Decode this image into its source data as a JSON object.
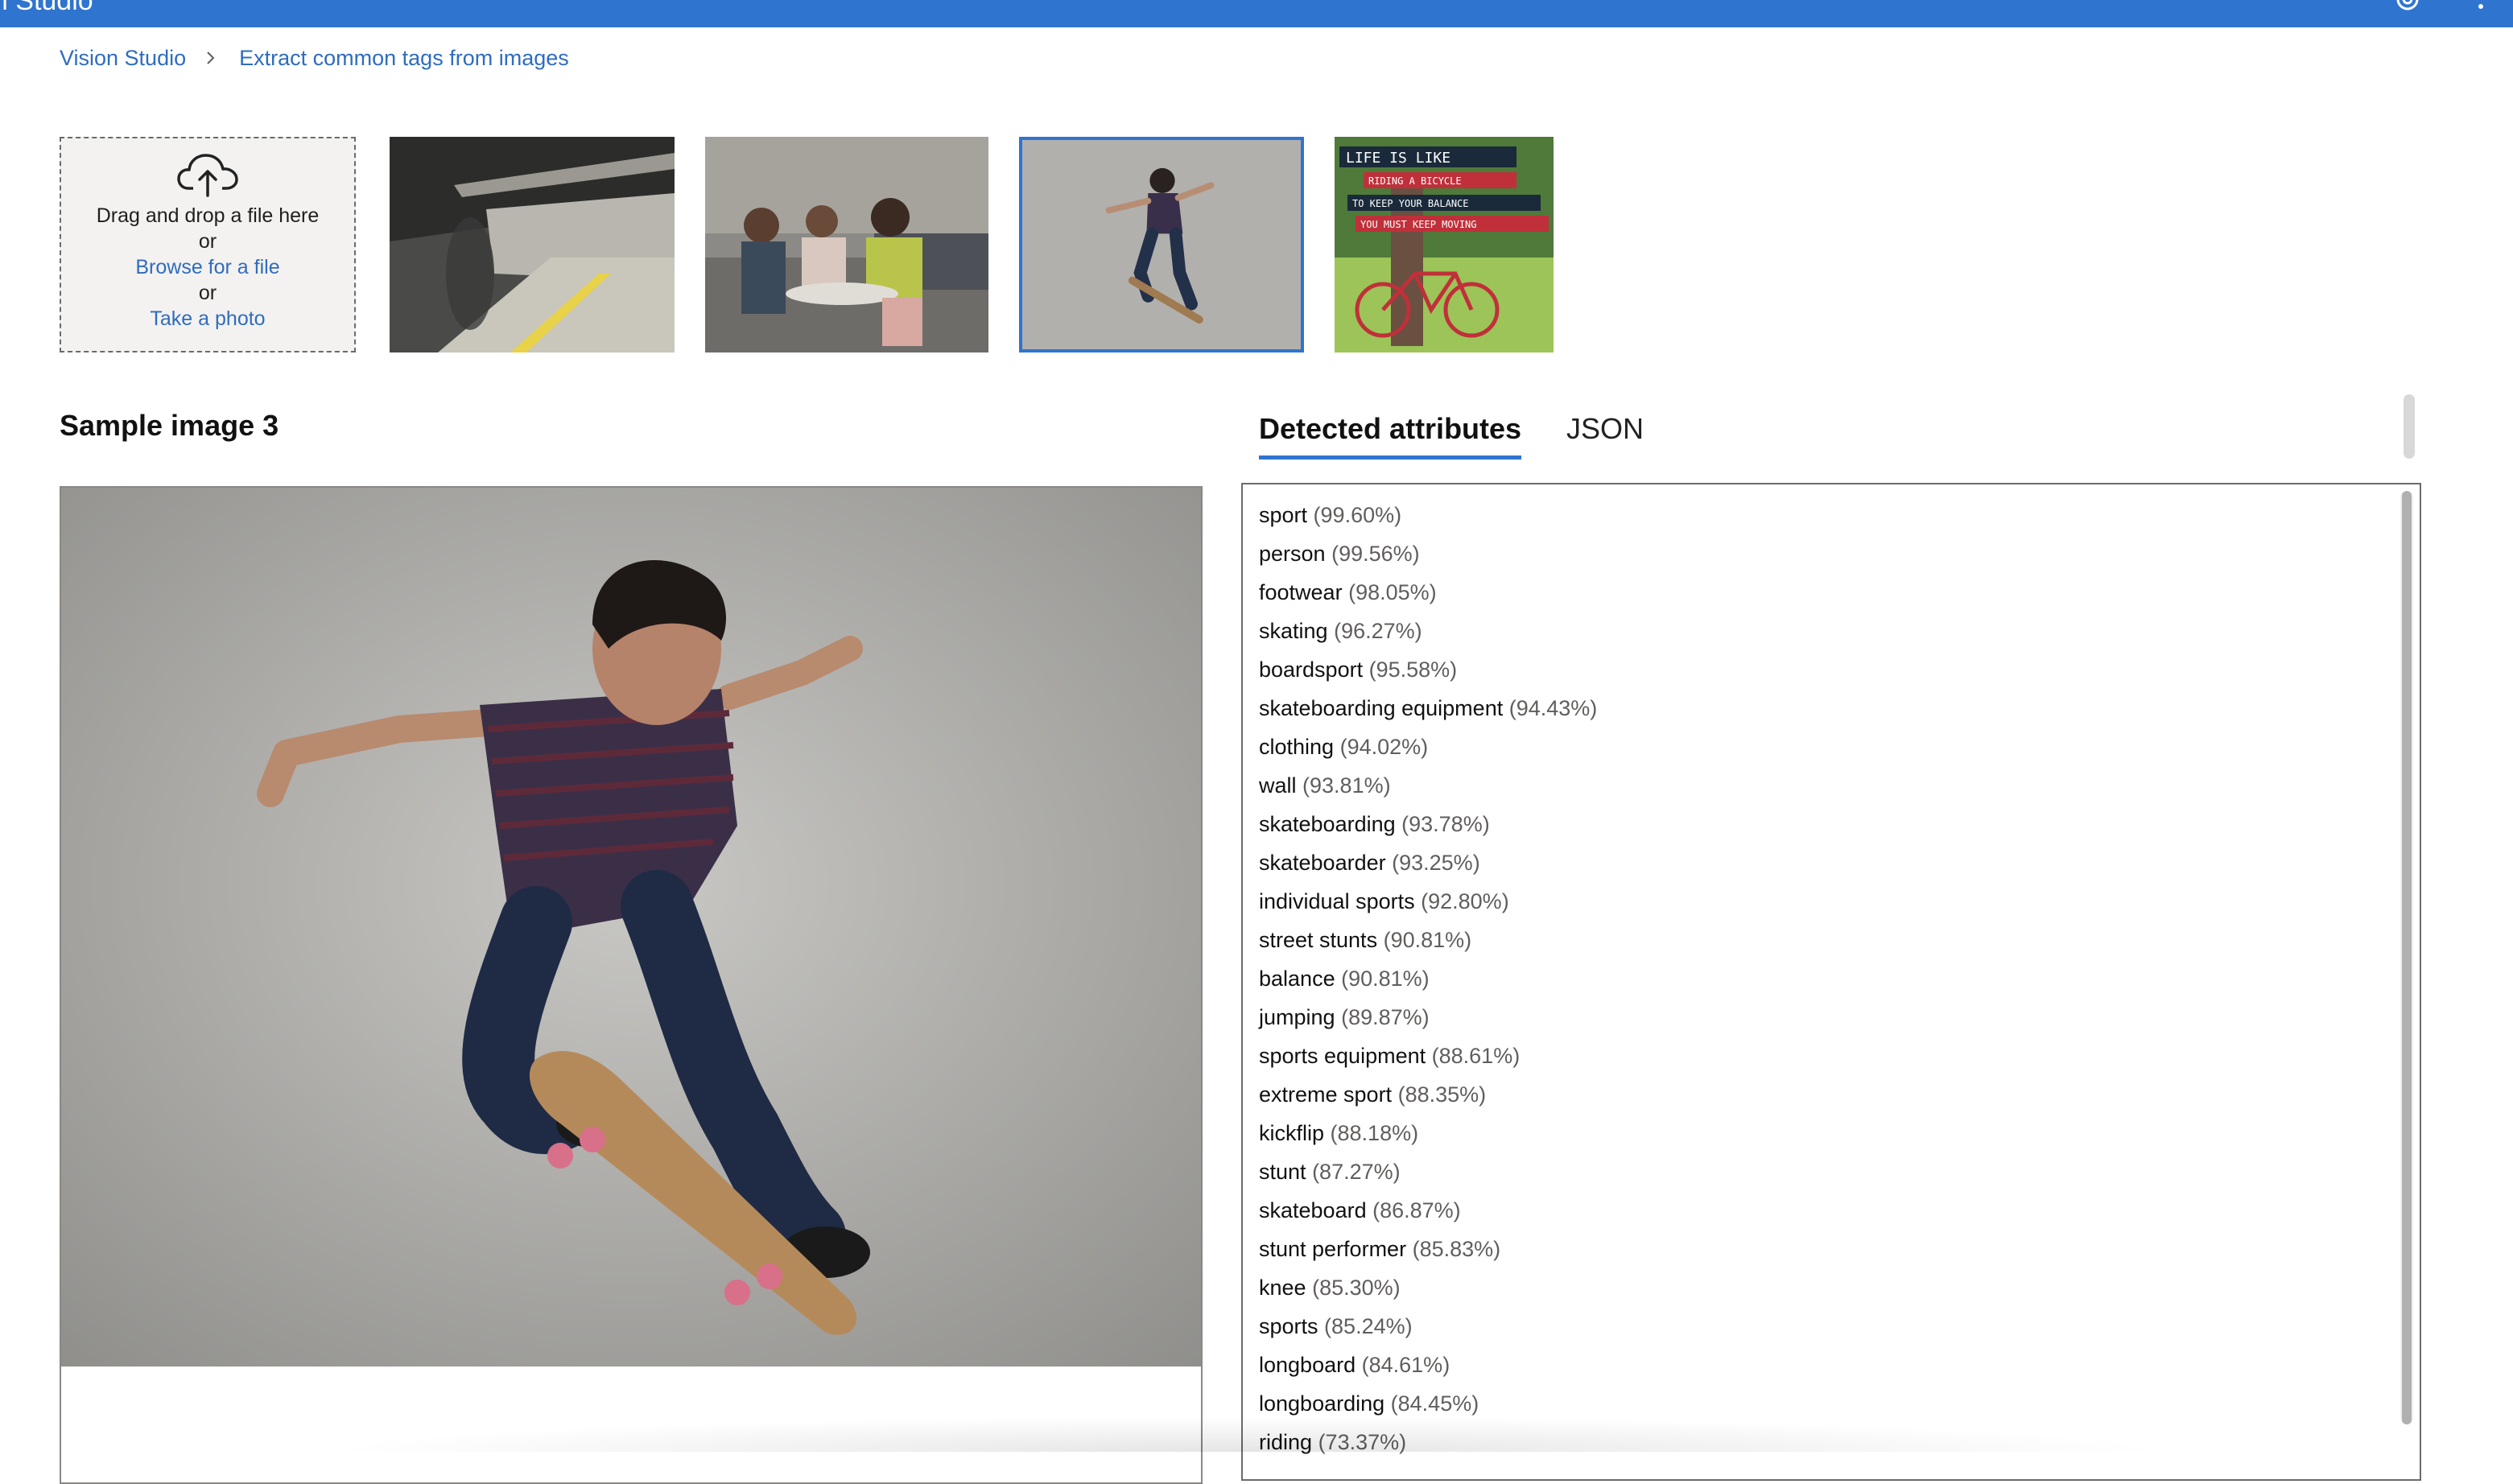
{
  "app": {
    "title": "Vision Studio"
  },
  "header": {
    "title_fragment": "on Studio",
    "settings_icon": "gear-icon",
    "more_icon": "more-vertical-icon",
    "bar_color": "#2f74cf"
  },
  "breadcrumb": {
    "home": "Vision Studio",
    "current": "Extract common tags from images"
  },
  "upload": {
    "line1": "Drag and drop a file here",
    "or1": "or",
    "browse": "Browse for a file",
    "or2": "or",
    "camera": "Take a photo",
    "icon": "cloud-upload-icon"
  },
  "samples": [
    {
      "name": "subway-platform",
      "selected": false
    },
    {
      "name": "office-meeting",
      "selected": false
    },
    {
      "name": "skateboarder",
      "selected": true
    },
    {
      "name": "bicycle-quote-poster",
      "selected": false,
      "poster_lines": [
        "LIFE IS LIKE",
        "RIDING A BICYCLE",
        "TO KEEP YOUR BALANCE",
        "YOU MUST KEEP MOVING"
      ]
    }
  ],
  "preview": {
    "title": "Sample image 3"
  },
  "tabs": [
    {
      "label": "Detected attributes",
      "active": true
    },
    {
      "label": "JSON",
      "active": false
    }
  ],
  "attributes": [
    {
      "name": "sport",
      "score": "(99.60%)"
    },
    {
      "name": "person",
      "score": "(99.56%)"
    },
    {
      "name": "footwear",
      "score": "(98.05%)"
    },
    {
      "name": "skating",
      "score": "(96.27%)"
    },
    {
      "name": "boardsport",
      "score": "(95.58%)"
    },
    {
      "name": "skateboarding equipment",
      "score": "(94.43%)"
    },
    {
      "name": "clothing",
      "score": "(94.02%)"
    },
    {
      "name": "wall",
      "score": "(93.81%)"
    },
    {
      "name": "skateboarding",
      "score": "(93.78%)"
    },
    {
      "name": "skateboarder",
      "score": "(93.25%)"
    },
    {
      "name": "individual sports",
      "score": "(92.80%)"
    },
    {
      "name": "street stunts",
      "score": "(90.81%)"
    },
    {
      "name": "balance",
      "score": "(90.81%)"
    },
    {
      "name": "jumping",
      "score": "(89.87%)"
    },
    {
      "name": "sports equipment",
      "score": "(88.61%)"
    },
    {
      "name": "extreme sport",
      "score": "(88.35%)"
    },
    {
      "name": "kickflip",
      "score": "(88.18%)"
    },
    {
      "name": "stunt",
      "score": "(87.27%)"
    },
    {
      "name": "skateboard",
      "score": "(86.87%)"
    },
    {
      "name": "stunt performer",
      "score": "(85.83%)"
    },
    {
      "name": "knee",
      "score": "(85.30%)"
    },
    {
      "name": "sports",
      "score": "(85.24%)"
    },
    {
      "name": "longboard",
      "score": "(84.61%)"
    },
    {
      "name": "longboarding",
      "score": "(84.45%)"
    },
    {
      "name": "riding",
      "score": "(73.37%)"
    }
  ]
}
